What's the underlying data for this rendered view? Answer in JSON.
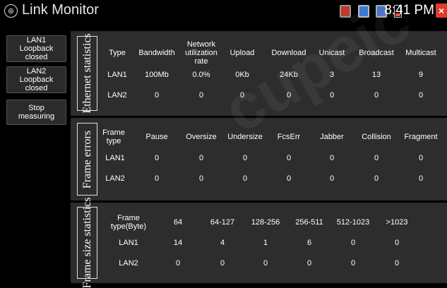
{
  "app": {
    "title": "Link Monitor",
    "logo_glyph": "⊛"
  },
  "status_bar": {
    "icons": [
      "storage-icon",
      "usb-icon",
      "network-off-icon",
      "battery-low-icon"
    ],
    "time": "8:41 PM",
    "close_glyph": "×"
  },
  "buttons": {
    "lan1_loopback": "LAN1 Loopback closed",
    "lan2_loopback": "LAN2 Loopback closed",
    "stop_measuring": "Stop measuring"
  },
  "ethernet": {
    "title": "Ethernet statistics",
    "headers": [
      "Type",
      "Bandwidth",
      "Network utilization rate",
      "Upload",
      "Download",
      "Unicast",
      "Broadcast",
      "Multicast"
    ],
    "rows": [
      [
        "LAN1",
        "100Mb",
        "0.0%",
        "0Kb",
        "24Kb",
        "3",
        "13",
        "9"
      ],
      [
        "LAN2",
        "0",
        "0",
        "0",
        "0",
        "0",
        "0",
        "0"
      ]
    ]
  },
  "errors": {
    "title": "Frame errors",
    "headers": [
      "Frame type",
      "Pause",
      "Oversize",
      "Undersize",
      "FcsErr",
      "Jabber",
      "Collision",
      "Fragment"
    ],
    "rows": [
      [
        "LAN1",
        "0",
        "0",
        "0",
        "0",
        "0",
        "0",
        "0"
      ],
      [
        "LAN2",
        "0",
        "0",
        "0",
        "0",
        "0",
        "0",
        "0"
      ]
    ]
  },
  "sizes": {
    "title": "Frame size statistics",
    "headers": [
      "Frame type(Byte)",
      "64",
      "64-127",
      "128-256",
      "256-511",
      "512-1023",
      ">1023"
    ],
    "rows": [
      [
        "LAN1",
        "14",
        "4",
        "1",
        "6",
        "0",
        "0"
      ],
      [
        "LAN2",
        "0",
        "0",
        "0",
        "0",
        "0",
        "0"
      ]
    ]
  },
  "watermark": "cupeic"
}
